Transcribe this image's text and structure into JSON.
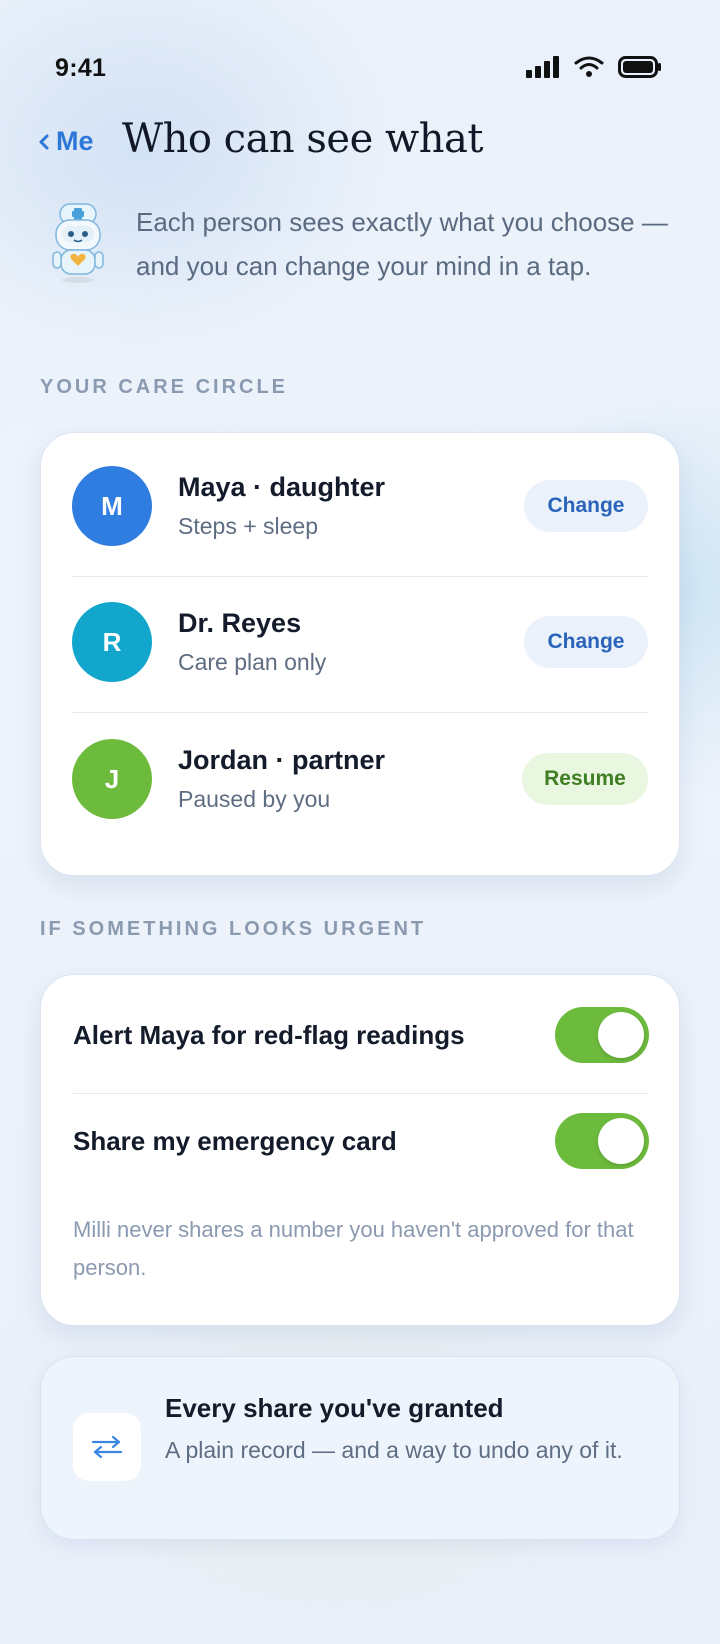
{
  "status_bar": {
    "time": "9:41"
  },
  "header": {
    "back_label": "Me",
    "title": "Who can see what"
  },
  "intro": {
    "text": "Each person sees exactly what you choose — and you can change your mind in a tap."
  },
  "care_circle": {
    "section_label": "YOUR CARE CIRCLE",
    "people": [
      {
        "initial": "M",
        "name": "Maya · daughter",
        "access": "Steps + sleep",
        "action": "Change",
        "avatar_color": "#2f7de0"
      },
      {
        "initial": "R",
        "name": "Dr. Reyes",
        "access": "Care plan only",
        "action": "Change",
        "avatar_color": "#12a6cc"
      },
      {
        "initial": "J",
        "name": "Jordan · partner",
        "access": "Paused by you",
        "action": "Resume",
        "avatar_color": "#6dbb3d"
      }
    ]
  },
  "urgent": {
    "section_label": "IF SOMETHING LOOKS URGENT",
    "toggles": [
      {
        "label": "Alert Maya for red-flag readings",
        "on": true
      },
      {
        "label": "Share my emergency card",
        "on": true
      }
    ],
    "fine_print": "Milli never shares a number you haven't approved for that person."
  },
  "history": {
    "title": "Every share you've granted",
    "subtitle": "A plain record — and a way to undo any of it.",
    "icon": "swap-arrows-icon"
  },
  "colors": {
    "accent": "#2d77d8",
    "toggle_on": "#6dbb3d",
    "resume_bg": "#e9f6e0",
    "change_bg": "#eaf1fb"
  }
}
